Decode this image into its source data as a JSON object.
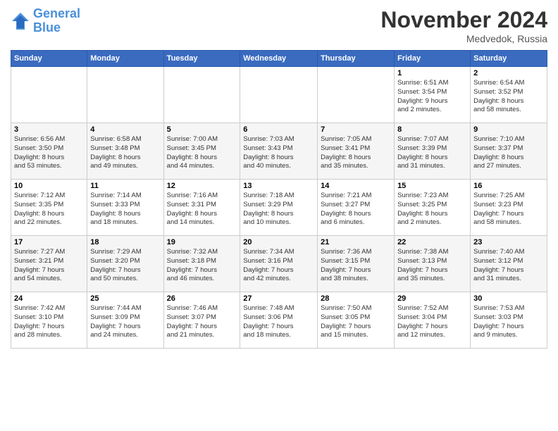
{
  "logo": {
    "line1": "General",
    "line2": "Blue"
  },
  "title": "November 2024",
  "location": "Medvedok, Russia",
  "weekdays": [
    "Sunday",
    "Monday",
    "Tuesday",
    "Wednesday",
    "Thursday",
    "Friday",
    "Saturday"
  ],
  "weeks": [
    [
      {
        "day": "",
        "info": ""
      },
      {
        "day": "",
        "info": ""
      },
      {
        "day": "",
        "info": ""
      },
      {
        "day": "",
        "info": ""
      },
      {
        "day": "",
        "info": ""
      },
      {
        "day": "1",
        "info": "Sunrise: 6:51 AM\nSunset: 3:54 PM\nDaylight: 9 hours\nand 2 minutes."
      },
      {
        "day": "2",
        "info": "Sunrise: 6:54 AM\nSunset: 3:52 PM\nDaylight: 8 hours\nand 58 minutes."
      }
    ],
    [
      {
        "day": "3",
        "info": "Sunrise: 6:56 AM\nSunset: 3:50 PM\nDaylight: 8 hours\nand 53 minutes."
      },
      {
        "day": "4",
        "info": "Sunrise: 6:58 AM\nSunset: 3:48 PM\nDaylight: 8 hours\nand 49 minutes."
      },
      {
        "day": "5",
        "info": "Sunrise: 7:00 AM\nSunset: 3:45 PM\nDaylight: 8 hours\nand 44 minutes."
      },
      {
        "day": "6",
        "info": "Sunrise: 7:03 AM\nSunset: 3:43 PM\nDaylight: 8 hours\nand 40 minutes."
      },
      {
        "day": "7",
        "info": "Sunrise: 7:05 AM\nSunset: 3:41 PM\nDaylight: 8 hours\nand 35 minutes."
      },
      {
        "day": "8",
        "info": "Sunrise: 7:07 AM\nSunset: 3:39 PM\nDaylight: 8 hours\nand 31 minutes."
      },
      {
        "day": "9",
        "info": "Sunrise: 7:10 AM\nSunset: 3:37 PM\nDaylight: 8 hours\nand 27 minutes."
      }
    ],
    [
      {
        "day": "10",
        "info": "Sunrise: 7:12 AM\nSunset: 3:35 PM\nDaylight: 8 hours\nand 22 minutes."
      },
      {
        "day": "11",
        "info": "Sunrise: 7:14 AM\nSunset: 3:33 PM\nDaylight: 8 hours\nand 18 minutes."
      },
      {
        "day": "12",
        "info": "Sunrise: 7:16 AM\nSunset: 3:31 PM\nDaylight: 8 hours\nand 14 minutes."
      },
      {
        "day": "13",
        "info": "Sunrise: 7:18 AM\nSunset: 3:29 PM\nDaylight: 8 hours\nand 10 minutes."
      },
      {
        "day": "14",
        "info": "Sunrise: 7:21 AM\nSunset: 3:27 PM\nDaylight: 8 hours\nand 6 minutes."
      },
      {
        "day": "15",
        "info": "Sunrise: 7:23 AM\nSunset: 3:25 PM\nDaylight: 8 hours\nand 2 minutes."
      },
      {
        "day": "16",
        "info": "Sunrise: 7:25 AM\nSunset: 3:23 PM\nDaylight: 7 hours\nand 58 minutes."
      }
    ],
    [
      {
        "day": "17",
        "info": "Sunrise: 7:27 AM\nSunset: 3:21 PM\nDaylight: 7 hours\nand 54 minutes."
      },
      {
        "day": "18",
        "info": "Sunrise: 7:29 AM\nSunset: 3:20 PM\nDaylight: 7 hours\nand 50 minutes."
      },
      {
        "day": "19",
        "info": "Sunrise: 7:32 AM\nSunset: 3:18 PM\nDaylight: 7 hours\nand 46 minutes."
      },
      {
        "day": "20",
        "info": "Sunrise: 7:34 AM\nSunset: 3:16 PM\nDaylight: 7 hours\nand 42 minutes."
      },
      {
        "day": "21",
        "info": "Sunrise: 7:36 AM\nSunset: 3:15 PM\nDaylight: 7 hours\nand 38 minutes."
      },
      {
        "day": "22",
        "info": "Sunrise: 7:38 AM\nSunset: 3:13 PM\nDaylight: 7 hours\nand 35 minutes."
      },
      {
        "day": "23",
        "info": "Sunrise: 7:40 AM\nSunset: 3:12 PM\nDaylight: 7 hours\nand 31 minutes."
      }
    ],
    [
      {
        "day": "24",
        "info": "Sunrise: 7:42 AM\nSunset: 3:10 PM\nDaylight: 7 hours\nand 28 minutes."
      },
      {
        "day": "25",
        "info": "Sunrise: 7:44 AM\nSunset: 3:09 PM\nDaylight: 7 hours\nand 24 minutes."
      },
      {
        "day": "26",
        "info": "Sunrise: 7:46 AM\nSunset: 3:07 PM\nDaylight: 7 hours\nand 21 minutes."
      },
      {
        "day": "27",
        "info": "Sunrise: 7:48 AM\nSunset: 3:06 PM\nDaylight: 7 hours\nand 18 minutes."
      },
      {
        "day": "28",
        "info": "Sunrise: 7:50 AM\nSunset: 3:05 PM\nDaylight: 7 hours\nand 15 minutes."
      },
      {
        "day": "29",
        "info": "Sunrise: 7:52 AM\nSunset: 3:04 PM\nDaylight: 7 hours\nand 12 minutes."
      },
      {
        "day": "30",
        "info": "Sunrise: 7:53 AM\nSunset: 3:03 PM\nDaylight: 7 hours\nand 9 minutes."
      }
    ]
  ]
}
